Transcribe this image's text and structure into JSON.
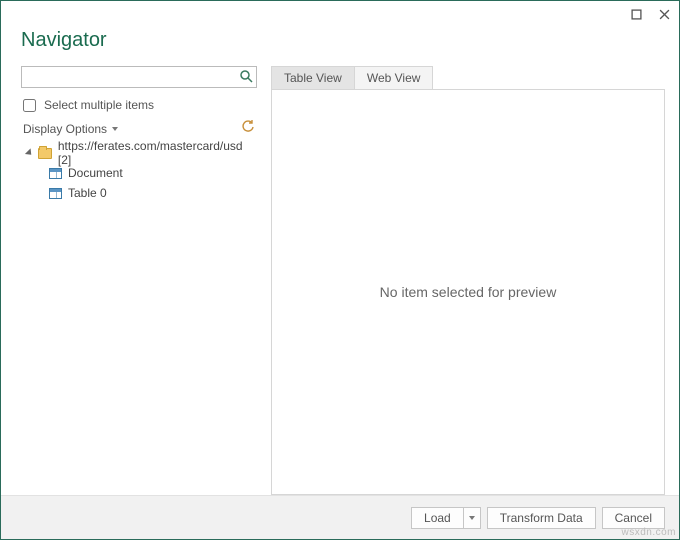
{
  "window": {
    "title": "Navigator"
  },
  "search": {
    "placeholder": ""
  },
  "options": {
    "select_multiple_label": "Select multiple items",
    "display_options_label": "Display Options"
  },
  "tree": {
    "root_label": "https://ferates.com/mastercard/usd [2]",
    "items": [
      "Document",
      "Table 0"
    ]
  },
  "tabs": {
    "table_view": "Table View",
    "web_view": "Web View"
  },
  "preview": {
    "empty_message": "No item selected for preview"
  },
  "footer": {
    "load_label": "Load",
    "transform_label": "Transform Data",
    "cancel_label": "Cancel"
  },
  "watermark": "wsxdn.com"
}
